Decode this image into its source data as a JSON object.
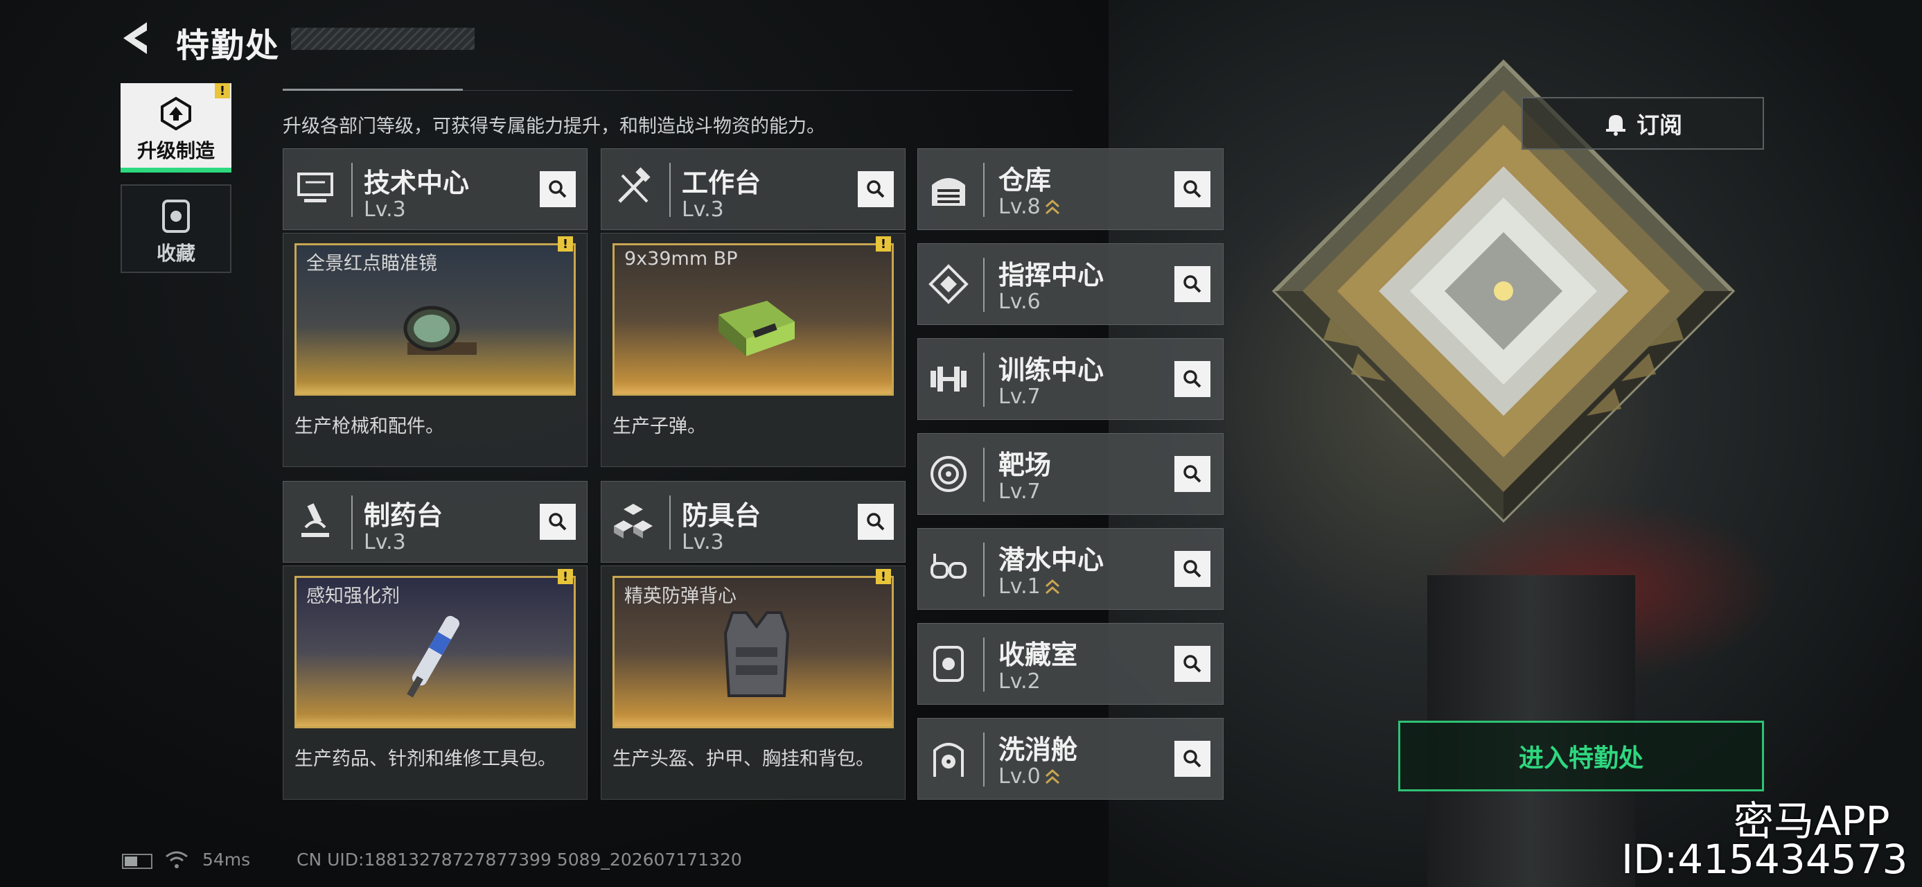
{
  "header": {
    "title": "特勤处",
    "subtitle": "升级各部门等级，可获得专属能力提升，和制造战斗物资的能力。"
  },
  "tabs": [
    {
      "label": "升级制造",
      "active": true,
      "alert": "!"
    },
    {
      "label": "收藏",
      "active": false
    }
  ],
  "modules": [
    {
      "name": "技术中心",
      "level": "Lv.3",
      "product": "全景红点瞄准镜",
      "alert": "!",
      "desc": "生产枪械和配件。",
      "icon": "monitor-icon"
    },
    {
      "name": "工作台",
      "level": "Lv.3",
      "product": "9x39mm BP",
      "alert": "!",
      "desc": "生产子弹。",
      "icon": "tools-icon"
    },
    {
      "name": "制药台",
      "level": "Lv.3",
      "product": "感知强化剂",
      "alert": "!",
      "desc": "生产药品、针剂和维修工具包。",
      "icon": "microscope-icon"
    },
    {
      "name": "防具台",
      "level": "Lv.3",
      "product": "精英防弹背心",
      "alert": "!",
      "desc": "生产头盔、护甲、胸挂和背包。",
      "icon": "cubes-icon"
    }
  ],
  "facilities": [
    {
      "name": "仓库",
      "level": "Lv.8",
      "upgradable": true,
      "icon": "warehouse-icon"
    },
    {
      "name": "指挥中心",
      "level": "Lv.6",
      "upgradable": false,
      "icon": "command-icon"
    },
    {
      "name": "训练中心",
      "level": "Lv.7",
      "upgradable": false,
      "icon": "dumbbell-icon"
    },
    {
      "name": "靶场",
      "level": "Lv.7",
      "upgradable": false,
      "icon": "target-icon"
    },
    {
      "name": "潜水中心",
      "level": "Lv.1",
      "upgradable": true,
      "icon": "goggles-icon"
    },
    {
      "name": "收藏室",
      "level": "Lv.2",
      "upgradable": false,
      "icon": "collection-icon"
    },
    {
      "name": "洗消舱",
      "level": "Lv.0",
      "upgradable": true,
      "icon": "radiation-icon"
    }
  ],
  "actions": {
    "subscribe": "订阅",
    "enter": "进入特勤处"
  },
  "status": {
    "ping": "54ms",
    "uid": "CN UID:18813278727877399 5089_202607171320"
  },
  "watermark": {
    "line1": "密马APP",
    "line2": "ID:415434573"
  },
  "colors": {
    "accent": "#2ed87f",
    "alert": "#e8c43a",
    "productFrame": "#c9a650"
  }
}
